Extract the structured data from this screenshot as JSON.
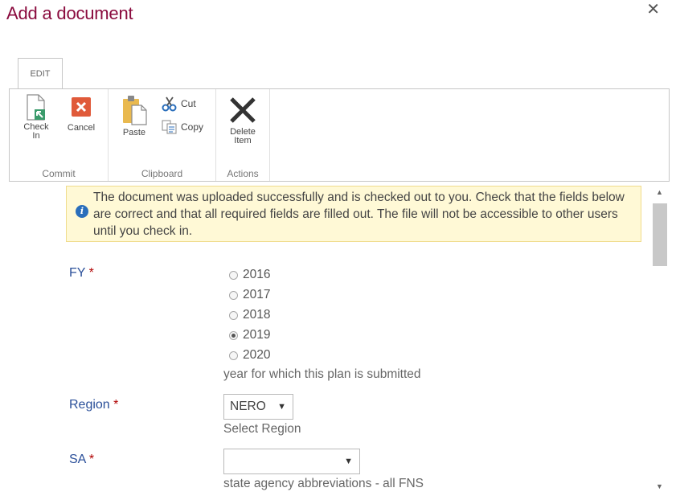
{
  "dialog": {
    "title": "Add a document",
    "close_glyph": "✕"
  },
  "ribbon": {
    "tab": "EDIT",
    "groups": {
      "commit": {
        "label": "Commit",
        "check_in_line1": "Check",
        "check_in_line2": "In",
        "cancel": "Cancel"
      },
      "clipboard": {
        "label": "Clipboard",
        "paste": "Paste",
        "cut": "Cut",
        "copy": "Copy"
      },
      "actions": {
        "label": "Actions",
        "delete_line1": "Delete",
        "delete_line2": "Item"
      }
    }
  },
  "notice": {
    "icon": "info-icon",
    "text": "The document was uploaded successfully and is checked out to you. Check that the fields below are correct and that all required fields are filled out. The file will not be accessible to other users until you check in."
  },
  "form": {
    "required_mark": "*",
    "fy": {
      "label": "FY",
      "options": [
        "2016",
        "2017",
        "2018",
        "2019",
        "2020"
      ],
      "selected": "2019",
      "hint": "year for which this plan is submitted"
    },
    "region": {
      "label": "Region",
      "value": "NERO",
      "hint": "Select Region"
    },
    "sa": {
      "label": "SA",
      "value": "",
      "hint": "state agency abbreviations - all FNS"
    }
  },
  "colors": {
    "title": "#8a0b3e",
    "label": "#2a4f99",
    "notice_bg": "#fff9d6",
    "cancel_red": "#e05a3a"
  }
}
